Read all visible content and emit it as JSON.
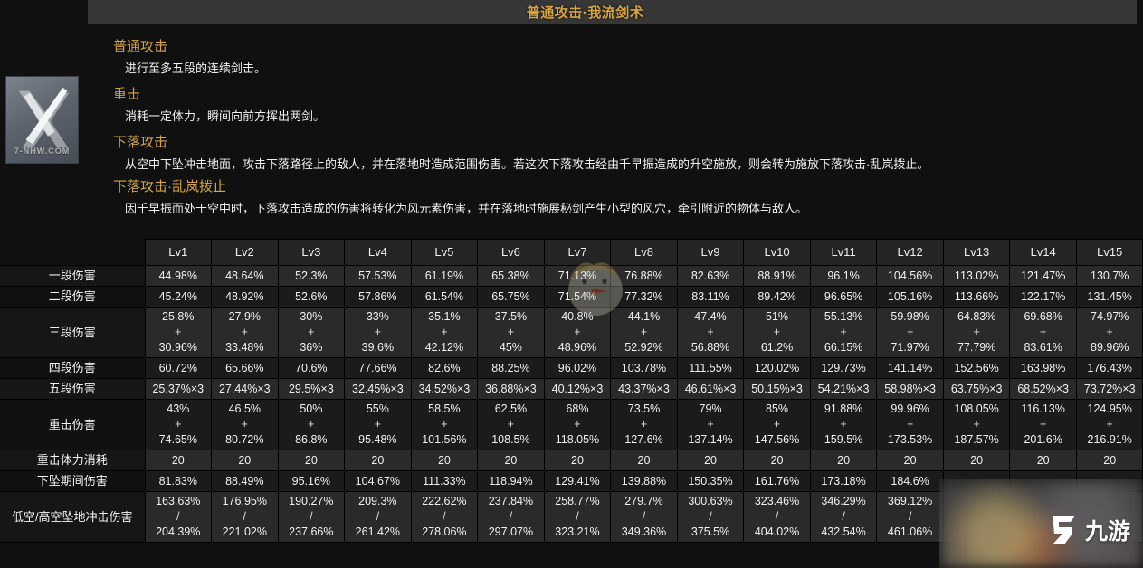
{
  "header": {
    "title": "普通攻击·我流剑术"
  },
  "icon": {
    "name": "sword-skill-icon",
    "watermark": "7-NHW.COM"
  },
  "description": {
    "sections": [
      {
        "heading": "普通攻击",
        "body": "进行至多五段的连续剑击。"
      },
      {
        "heading": "重击",
        "body": "消耗一定体力，瞬间向前方挥出两剑。"
      },
      {
        "heading": "下落攻击",
        "body": "从空中下坠冲击地面，攻击下落路径上的敌人，并在落地时造成范围伤害。若这次下落攻击经由千早振造成的升空施放，则会转为施放下落攻击·乱岚拨止。"
      },
      {
        "heading": "下落攻击·乱岚拨止",
        "body": "因千早振而处于空中时，下落攻击造成的伤害将转化为风元素伤害，并在落地时施展秘剑产生小型的风穴，牵引附近的物体与敌人。"
      }
    ]
  },
  "table": {
    "corner": "",
    "columns": [
      "Lv1",
      "Lv2",
      "Lv3",
      "Lv4",
      "Lv5",
      "Lv6",
      "Lv7",
      "Lv8",
      "Lv9",
      "Lv10",
      "Lv11",
      "Lv12",
      "Lv13",
      "Lv14",
      "Lv15"
    ],
    "rows": [
      {
        "label": "一段伤害",
        "type": "single",
        "values": [
          "44.98%",
          "48.64%",
          "52.3%",
          "57.53%",
          "61.19%",
          "65.38%",
          "71.13%",
          "76.88%",
          "82.63%",
          "88.91%",
          "96.1%",
          "104.56%",
          "113.02%",
          "121.47%",
          "130.7%"
        ]
      },
      {
        "label": "二段伤害",
        "type": "single",
        "values": [
          "45.24%",
          "48.92%",
          "52.6%",
          "57.86%",
          "61.54%",
          "65.75%",
          "71.54%",
          "77.32%",
          "83.11%",
          "89.42%",
          "96.65%",
          "105.16%",
          "113.66%",
          "122.17%",
          "131.45%"
        ]
      },
      {
        "label": "三段伤害",
        "type": "plus",
        "separator": "+",
        "values_top": [
          "25.8%",
          "27.9%",
          "30%",
          "33%",
          "35.1%",
          "37.5%",
          "40.8%",
          "44.1%",
          "47.4%",
          "51%",
          "55.13%",
          "59.98%",
          "64.83%",
          "69.68%",
          "74.97%"
        ],
        "values_bottom": [
          "30.96%",
          "33.48%",
          "36%",
          "39.6%",
          "42.12%",
          "45%",
          "48.96%",
          "52.92%",
          "56.88%",
          "61.2%",
          "66.15%",
          "71.97%",
          "77.79%",
          "83.61%",
          "89.96%"
        ]
      },
      {
        "label": "四段伤害",
        "type": "single",
        "values": [
          "60.72%",
          "65.66%",
          "70.6%",
          "77.66%",
          "82.6%",
          "88.25%",
          "96.02%",
          "103.78%",
          "111.55%",
          "120.02%",
          "129.73%",
          "141.14%",
          "152.56%",
          "163.98%",
          "176.43%"
        ]
      },
      {
        "label": "五段伤害",
        "type": "single",
        "values": [
          "25.37%×3",
          "27.44%×3",
          "29.5%×3",
          "32.45%×3",
          "34.52%×3",
          "36.88%×3",
          "40.12%×3",
          "43.37%×3",
          "46.61%×3",
          "50.15%×3",
          "54.21%×3",
          "58.98%×3",
          "63.75%×3",
          "68.52%×3",
          "73.72%×3"
        ]
      },
      {
        "label": "重击伤害",
        "type": "plus",
        "separator": "+",
        "values_top": [
          "43%",
          "46.5%",
          "50%",
          "55%",
          "58.5%",
          "62.5%",
          "68%",
          "73.5%",
          "79%",
          "85%",
          "91.88%",
          "99.96%",
          "108.05%",
          "116.13%",
          "124.95%"
        ],
        "values_bottom": [
          "74.65%",
          "80.72%",
          "86.8%",
          "95.48%",
          "101.56%",
          "108.5%",
          "118.05%",
          "127.6%",
          "137.14%",
          "147.56%",
          "159.5%",
          "173.53%",
          "187.57%",
          "201.6%",
          "216.91%"
        ]
      },
      {
        "label": "重击体力消耗",
        "type": "single",
        "values": [
          "20",
          "20",
          "20",
          "20",
          "20",
          "20",
          "20",
          "20",
          "20",
          "20",
          "20",
          "20",
          "20",
          "20",
          "20"
        ]
      },
      {
        "label": "下坠期间伤害",
        "type": "single",
        "values": [
          "81.83%",
          "88.49%",
          "95.16%",
          "104.67%",
          "111.33%",
          "118.94%",
          "129.41%",
          "139.88%",
          "150.35%",
          "161.76%",
          "173.18%",
          "184.6%",
          "",
          "",
          ""
        ]
      },
      {
        "label": "低空/高空坠地冲击伤害",
        "type": "plus",
        "separator": "/",
        "values_top": [
          "163.63%",
          "176.95%",
          "190.27%",
          "209.3%",
          "222.62%",
          "237.84%",
          "258.77%",
          "279.7%",
          "300.63%",
          "323.46%",
          "346.29%",
          "369.12%",
          "",
          "",
          ""
        ],
        "values_bottom": [
          "204.39%",
          "221.02%",
          "237.66%",
          "261.42%",
          "278.06%",
          "297.07%",
          "323.21%",
          "349.36%",
          "375.5%",
          "404.02%",
          "432.54%",
          "461.06%",
          "",
          "",
          ""
        ]
      }
    ]
  },
  "watermarks": {
    "mascot": "chick-mascot-watermark",
    "corner_logo": "九游",
    "corner_logo_icon": "jiuyou-logo-icon"
  },
  "colors": {
    "accent_gold": "#d3a44a",
    "title_gold": "#d6a442",
    "panel_bg": "#101010",
    "titlebar_bg": "#373737",
    "cell_light": "#2a2a2a",
    "cell_dark": "#1b1b1b"
  }
}
